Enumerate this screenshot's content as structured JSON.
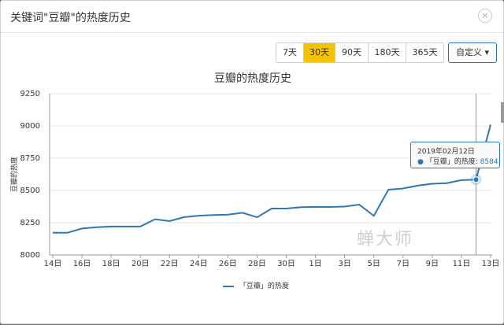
{
  "dialog": {
    "title": "关键词\"豆瓣\"的热度历史",
    "close_label": "×"
  },
  "range_buttons": [
    {
      "label": "7天"
    },
    {
      "label": "30天"
    },
    {
      "label": "90天"
    },
    {
      "label": "180天"
    },
    {
      "label": "365天"
    }
  ],
  "active_range": "30天",
  "custom": {
    "label": "自定义 ▾"
  },
  "tooltip": {
    "date": "2019年02月12日",
    "series": "「豆瓣」的热度:",
    "value": "8584"
  },
  "watermark": "蝉大师",
  "colors": {
    "line": "#2d78b4",
    "active_button": "#f3c300",
    "grid": "#e6e6e6"
  },
  "chart_data": {
    "type": "line",
    "title": "豆瓣的热度历史",
    "ylabel": "豆瓣的热度",
    "xlabel": "",
    "ylim": [
      8000,
      9250
    ],
    "yticks": [
      8000,
      8250,
      8500,
      8750,
      9000,
      9250
    ],
    "grid": true,
    "legend": "bottom-center",
    "x": [
      "14日",
      "15日",
      "16日",
      "17日",
      "18日",
      "19日",
      "20日",
      "21日",
      "22日",
      "23日",
      "24日",
      "25日",
      "26日",
      "27日",
      "28日",
      "29日",
      "30日",
      "31日",
      "1日",
      "2日",
      "3日",
      "4日",
      "5日",
      "6日",
      "7日",
      "8日",
      "9日",
      "10日",
      "11日",
      "12日",
      "13日"
    ],
    "x_tick_labels": [
      "14日",
      "16日",
      "18日",
      "20日",
      "22日",
      "24日",
      "26日",
      "28日",
      "30日",
      "1日",
      "3日",
      "5日",
      "7日",
      "9日",
      "11日",
      "13日"
    ],
    "series": [
      {
        "name": "「豆瓣」的热度",
        "values": [
          8172,
          8172,
          8205,
          8215,
          8220,
          8220,
          8220,
          8277,
          8262,
          8293,
          8304,
          8310,
          8313,
          8327,
          8292,
          8360,
          8360,
          8370,
          8372,
          8372,
          8375,
          8390,
          8303,
          8507,
          8515,
          8537,
          8552,
          8557,
          8580,
          8584,
          9010
        ]
      }
    ]
  }
}
